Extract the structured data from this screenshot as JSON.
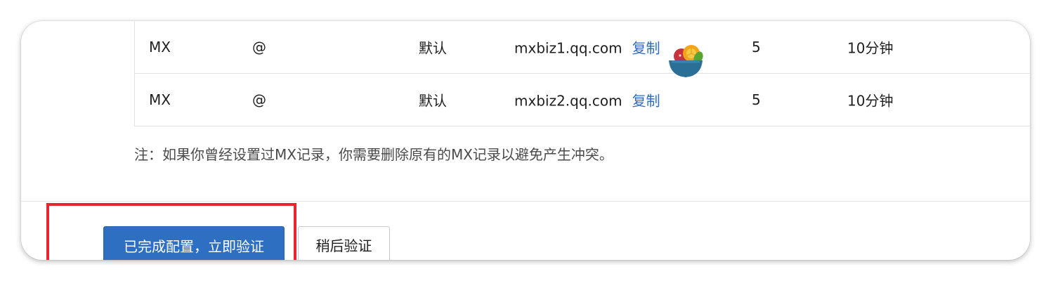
{
  "table": {
    "rows": [
      {
        "type": "MX",
        "host": "@",
        "line": "默认",
        "value": "mxbiz1.qq.com",
        "copy": "复制",
        "priority": "5",
        "ttl": "10分钟"
      },
      {
        "type": "MX",
        "host": "@",
        "line": "默认",
        "value": "mxbiz2.qq.com",
        "copy": "复制",
        "priority": "5",
        "ttl": "10分钟"
      }
    ]
  },
  "note": "注：如果你曾经设置过MX记录，你需要删除原有的MX记录以避免产生冲突。",
  "actions": {
    "confirm_label": "已完成配置，立即验证",
    "later_label": "稍后验证"
  },
  "overlay": {
    "sticker_icon": "fruit-bowl-emoji-icon",
    "highlight_color": "#e8262d"
  },
  "colors": {
    "primary": "#2f6fc1",
    "link": "#2d6bbf"
  }
}
